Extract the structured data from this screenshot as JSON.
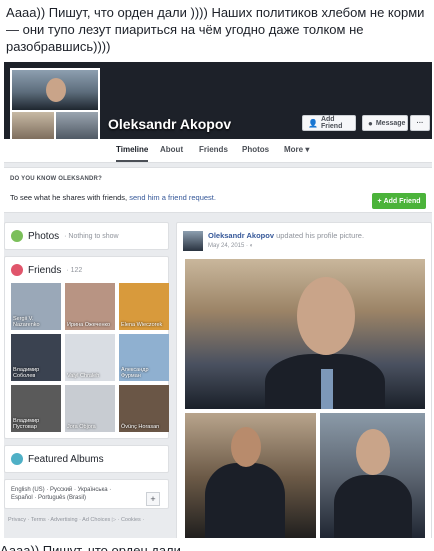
{
  "caption": "Аааа)) Пишут, что орден дали )))) Наших политиков хлебом не корми — они тупо лезут пиариться на чём угодно даже толком не разобравшись))))",
  "profile": {
    "name": "Oleksandr Akopov",
    "buttons": {
      "add_friend": "Add Friend",
      "message": "Message",
      "more": "···"
    },
    "tabs": [
      "Timeline",
      "About",
      "Friends",
      "Photos",
      "More ▾"
    ]
  },
  "know": {
    "title": "DO YOU KNOW OLEKSANDR?",
    "text": "To see what he shares with friends,",
    "link": "send him a friend request.",
    "button": "Add Friend"
  },
  "photos_box": {
    "title": "Photos",
    "subtitle": "· Nothing to show"
  },
  "friends_box": {
    "title": "Friends",
    "count": "· 122",
    "items": [
      {
        "name": "Sergii V. Nazarenko",
        "bg": "#9aa8b8"
      },
      {
        "name": "Ирина Ожеченко",
        "bg": "#b89483"
      },
      {
        "name": "Elena Wieczorek",
        "bg": "#d89a3c"
      },
      {
        "name": "Владимир Соболев",
        "bg": "#3a4250"
      },
      {
        "name": "Valyl Chraleh",
        "bg": "#d9dde3"
      },
      {
        "name": "Александр Фурман",
        "bg": "#8fb0d0"
      },
      {
        "name": "Владимир Пустовар",
        "bg": "#5a5a5a"
      },
      {
        "name": "Jora Objora",
        "bg": "#c8ccd2"
      },
      {
        "name": "Övünç Horasan",
        "bg": "#6a5646"
      }
    ]
  },
  "albums_box": {
    "title": "Featured Albums"
  },
  "languages": {
    "text": "English (US) · Русский · Українська · Español · Português (Brasil)",
    "plus": "+"
  },
  "footer": "Privacy · Terms · Advertising · Ad Choices ▷ · Cookies ·",
  "post": {
    "author": "Oleksandr Akopov",
    "action": "updated his profile picture.",
    "date": "May 24, 2015 · ◐"
  },
  "bottom_text": "Аааа))  Пишут, что орден дали"
}
